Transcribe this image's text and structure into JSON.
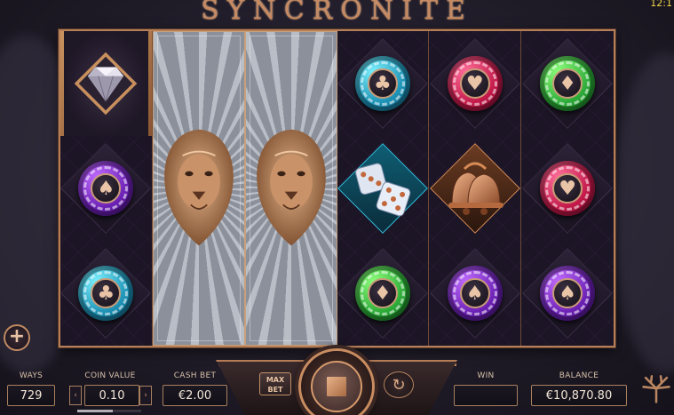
{
  "game": {
    "title": "SYNCRONITE",
    "clock": "12:1"
  },
  "reels": [
    {
      "type": "symbols",
      "symbols": [
        "diamond-gem",
        "purple-spade-chip",
        "teal-club-chip"
      ]
    },
    {
      "type": "lion",
      "symbols": [
        "lion-head"
      ]
    },
    {
      "type": "lion",
      "symbols": [
        "lion-head"
      ]
    },
    {
      "type": "symbols",
      "symbols": [
        "teal-club-chip",
        "dice",
        "green-diamond-chip"
      ]
    },
    {
      "type": "symbols",
      "symbols": [
        "red-heart-chip",
        "bells",
        "purple-spade-chip"
      ]
    },
    {
      "type": "symbols",
      "symbols": [
        "green-diamond-chip",
        "red-heart-chip",
        "purple-spade-chip"
      ]
    }
  ],
  "colors": {
    "accent": "#c58a63",
    "frame": "#b77f58"
  },
  "controls": {
    "ways_label": "WAYS",
    "ways_value": "729",
    "coin_value_label": "COIN VALUE",
    "coin_value": "0.10",
    "coin_level_fraction": 0.55,
    "cash_bet_label": "CASH BET",
    "cash_bet_value": "€2.00",
    "max_bet_line1": "MAX",
    "max_bet_line2": "BET",
    "win_label": "WIN",
    "win_value": "",
    "balance_label": "BALANCE",
    "balance_value": "€10,870.80",
    "decrease_symbol": "‹",
    "increase_symbol": "›",
    "plus_symbol": "+",
    "autoplay_symbol": "↻"
  }
}
